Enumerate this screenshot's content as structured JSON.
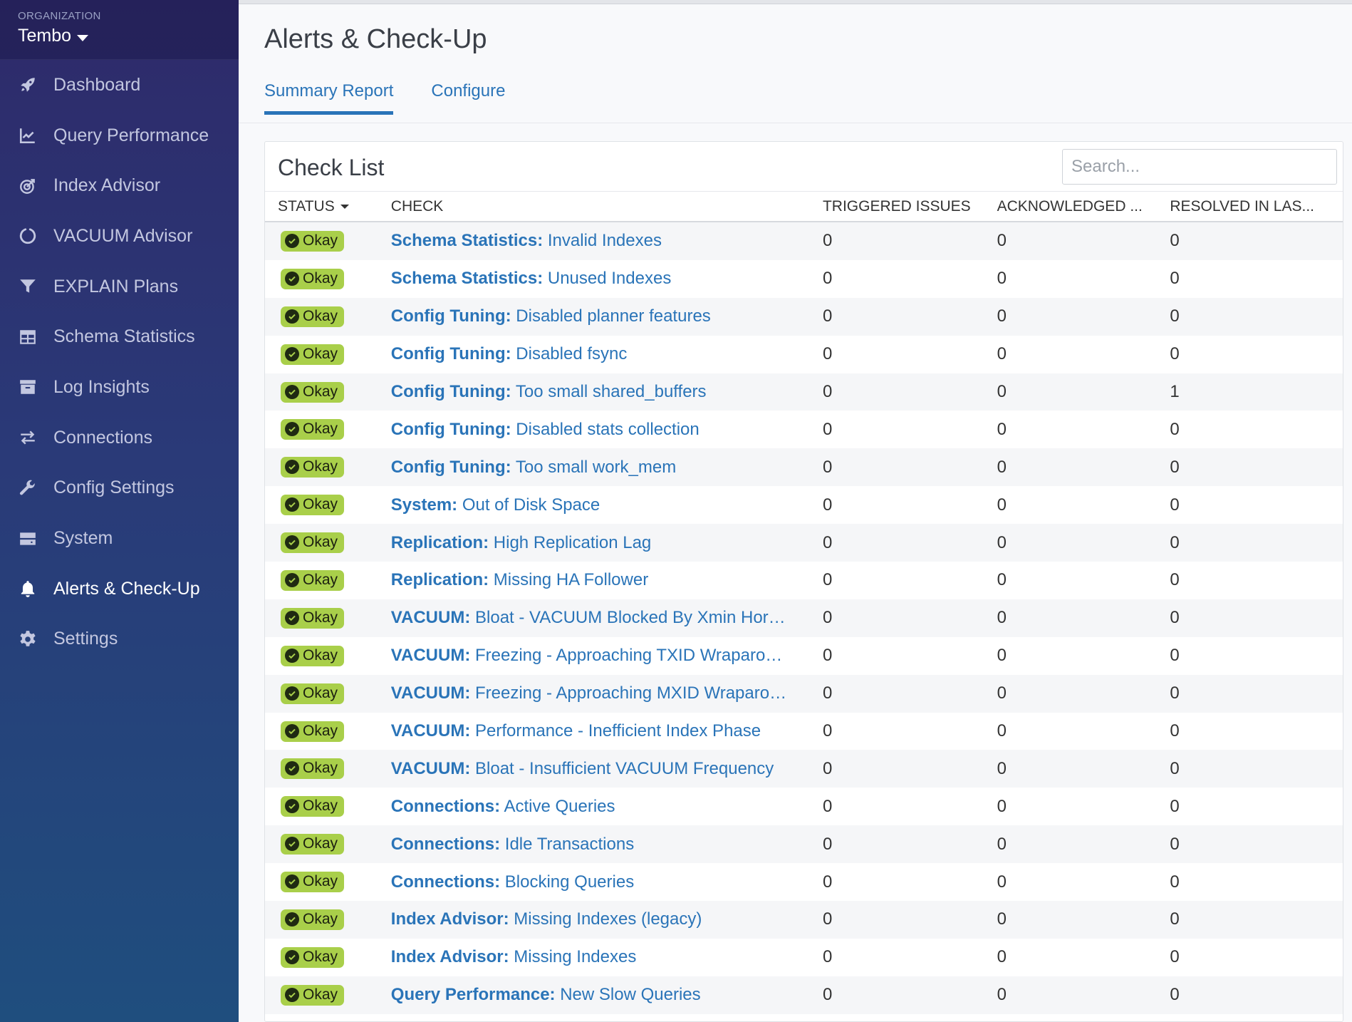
{
  "sidebar": {
    "org_label": "ORGANIZATION",
    "org_name": "Tembo",
    "items": [
      {
        "label": "Dashboard",
        "icon": "rocket-icon"
      },
      {
        "label": "Query Performance",
        "icon": "line-chart-icon"
      },
      {
        "label": "Index Advisor",
        "icon": "target-icon"
      },
      {
        "label": "VACUUM Advisor",
        "icon": "circle-notch-icon"
      },
      {
        "label": "EXPLAIN Plans",
        "icon": "filter-icon"
      },
      {
        "label": "Schema Statistics",
        "icon": "table-icon"
      },
      {
        "label": "Log Insights",
        "icon": "archive-icon"
      },
      {
        "label": "Connections",
        "icon": "exchange-icon"
      },
      {
        "label": "Config Settings",
        "icon": "wrench-icon"
      },
      {
        "label": "System",
        "icon": "server-icon"
      },
      {
        "label": "Alerts & Check-Up",
        "icon": "bell-icon"
      },
      {
        "label": "Settings",
        "icon": "gear-icon"
      }
    ],
    "active": "Alerts & Check-Up"
  },
  "page": {
    "title": "Alerts & Check-Up",
    "tabs": [
      "Summary Report",
      "Configure"
    ],
    "active_tab": "Summary Report"
  },
  "checklist": {
    "title": "Check List",
    "search_placeholder": "Search...",
    "headers": {
      "status": "STATUS",
      "check": "CHECK",
      "triggered": "TRIGGERED ISSUES",
      "acknowledged": "ACKNOWLEDGED ...",
      "resolved": "RESOLVED IN LAS..."
    },
    "rows": [
      {
        "status": "Okay",
        "category": "Schema Statistics:",
        "name": "Invalid Indexes",
        "triggered": "0",
        "acknowledged": "0",
        "resolved": "0"
      },
      {
        "status": "Okay",
        "category": "Schema Statistics:",
        "name": "Unused Indexes",
        "triggered": "0",
        "acknowledged": "0",
        "resolved": "0"
      },
      {
        "status": "Okay",
        "category": "Config Tuning:",
        "name": "Disabled planner features",
        "triggered": "0",
        "acknowledged": "0",
        "resolved": "0"
      },
      {
        "status": "Okay",
        "category": "Config Tuning:",
        "name": "Disabled fsync",
        "triggered": "0",
        "acknowledged": "0",
        "resolved": "0"
      },
      {
        "status": "Okay",
        "category": "Config Tuning:",
        "name": "Too small shared_buffers",
        "triggered": "0",
        "acknowledged": "0",
        "resolved": "1"
      },
      {
        "status": "Okay",
        "category": "Config Tuning:",
        "name": "Disabled stats collection",
        "triggered": "0",
        "acknowledged": "0",
        "resolved": "0"
      },
      {
        "status": "Okay",
        "category": "Config Tuning:",
        "name": "Too small work_mem",
        "triggered": "0",
        "acknowledged": "0",
        "resolved": "0"
      },
      {
        "status": "Okay",
        "category": "System:",
        "name": "Out of Disk Space",
        "triggered": "0",
        "acknowledged": "0",
        "resolved": "0"
      },
      {
        "status": "Okay",
        "category": "Replication:",
        "name": "High Replication Lag",
        "triggered": "0",
        "acknowledged": "0",
        "resolved": "0"
      },
      {
        "status": "Okay",
        "category": "Replication:",
        "name": "Missing HA Follower",
        "triggered": "0",
        "acknowledged": "0",
        "resolved": "0"
      },
      {
        "status": "Okay",
        "category": "VACUUM:",
        "name": "Bloat - VACUUM Blocked By Xmin Hor…",
        "triggered": "0",
        "acknowledged": "0",
        "resolved": "0"
      },
      {
        "status": "Okay",
        "category": "VACUUM:",
        "name": "Freezing - Approaching TXID Wraparo…",
        "triggered": "0",
        "acknowledged": "0",
        "resolved": "0"
      },
      {
        "status": "Okay",
        "category": "VACUUM:",
        "name": "Freezing - Approaching MXID Wraparo…",
        "triggered": "0",
        "acknowledged": "0",
        "resolved": "0"
      },
      {
        "status": "Okay",
        "category": "VACUUM:",
        "name": "Performance - Inefficient Index Phase",
        "triggered": "0",
        "acknowledged": "0",
        "resolved": "0"
      },
      {
        "status": "Okay",
        "category": "VACUUM:",
        "name": "Bloat - Insufficient VACUUM Frequency",
        "triggered": "0",
        "acknowledged": "0",
        "resolved": "0"
      },
      {
        "status": "Okay",
        "category": "Connections:",
        "name": "Active Queries",
        "triggered": "0",
        "acknowledged": "0",
        "resolved": "0"
      },
      {
        "status": "Okay",
        "category": "Connections:",
        "name": "Idle Transactions",
        "triggered": "0",
        "acknowledged": "0",
        "resolved": "0"
      },
      {
        "status": "Okay",
        "category": "Connections:",
        "name": "Blocking Queries",
        "triggered": "0",
        "acknowledged": "0",
        "resolved": "0"
      },
      {
        "status": "Okay",
        "category": "Index Advisor:",
        "name": "Missing Indexes (legacy)",
        "triggered": "0",
        "acknowledged": "0",
        "resolved": "0"
      },
      {
        "status": "Okay",
        "category": "Index Advisor:",
        "name": "Missing Indexes",
        "triggered": "0",
        "acknowledged": "0",
        "resolved": "0"
      },
      {
        "status": "Okay",
        "category": "Query Performance:",
        "name": "New Slow Queries",
        "triggered": "0",
        "acknowledged": "0",
        "resolved": "0"
      }
    ]
  },
  "colors": {
    "accent": "#2a74b8",
    "okay_badge": "#a9cf4a",
    "sidebar_top": "#2e2a6a",
    "sidebar_bottom": "#1f4e7e"
  }
}
